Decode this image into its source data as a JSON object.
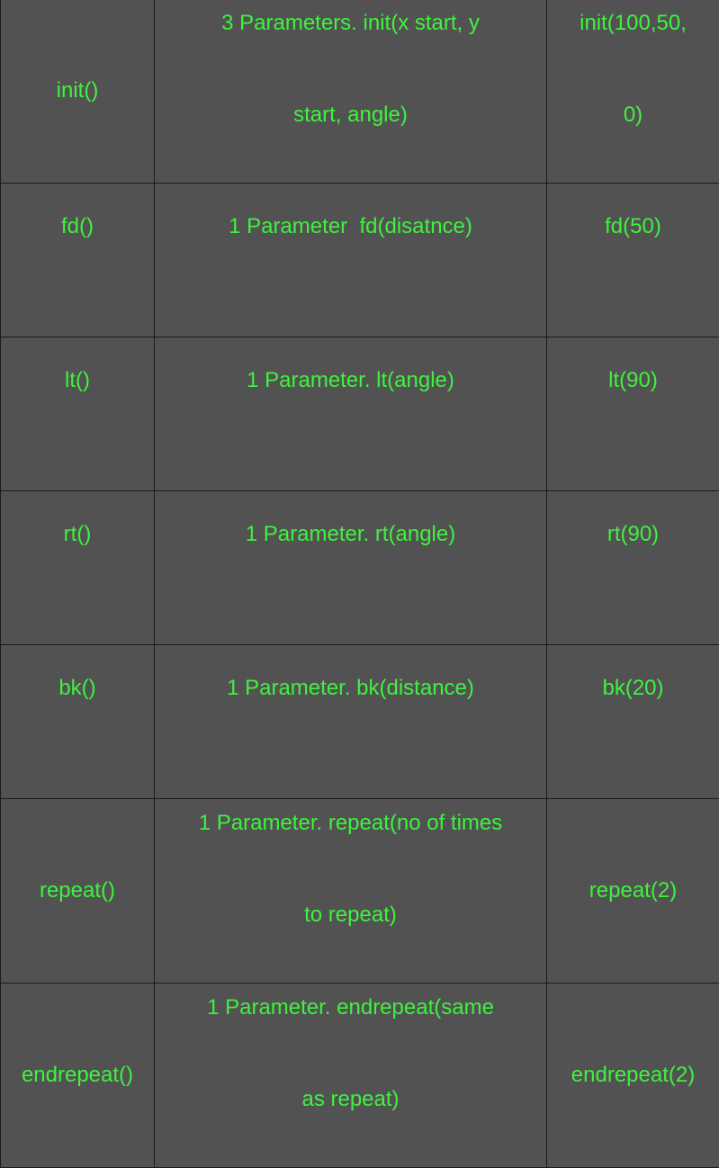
{
  "rows": [
    {
      "command": "init()",
      "description_lines": [
        "3 Parameters. init(x start, y",
        "start, angle)"
      ],
      "example_lines": [
        "init(100,50,",
        "0)"
      ]
    },
    {
      "command": "fd()",
      "description": "1 Parameter  fd(disatnce)",
      "example": "fd(50)"
    },
    {
      "command": "lt()",
      "description": "1 Parameter. lt(angle)",
      "example": "lt(90)"
    },
    {
      "command": "rt()",
      "description": "1 Parameter. rt(angle)",
      "example": "rt(90)"
    },
    {
      "command": "bk()",
      "description": "1 Parameter. bk(distance)",
      "example": "bk(20)"
    },
    {
      "command": "repeat()",
      "description_lines": [
        "1 Parameter. repeat(no of times",
        "to repeat)"
      ],
      "example": "repeat(2)"
    },
    {
      "command": "endrepeat()",
      "description_lines": [
        "1 Parameter. endrepeat(same",
        "as repeat)"
      ],
      "example": "endrepeat(2)"
    }
  ],
  "colors": {
    "background": "#525252",
    "text": "#3ef23e",
    "border": "#1c1c1c"
  }
}
